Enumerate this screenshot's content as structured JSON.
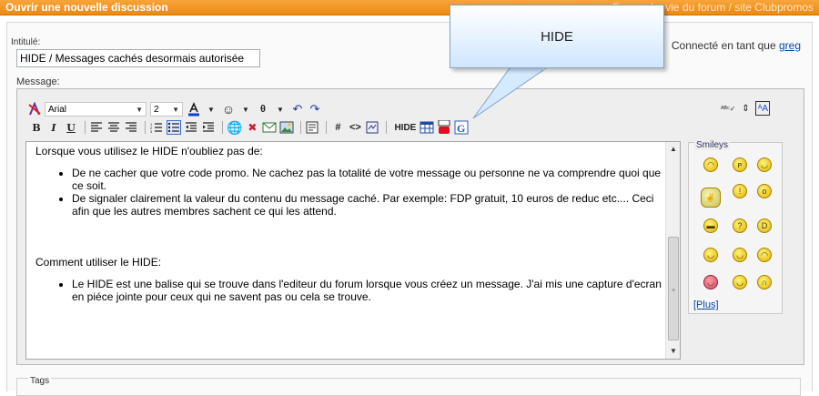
{
  "header": {
    "title": "Ouvrir une nouvelle discussion",
    "forum_text": "Forum: La vie du forum / site Clubpromos"
  },
  "form": {
    "subject_label": "Intitulé:",
    "subject_value": "HIDE / Messages cachés desormais autorisée",
    "connected_prefix": "Connecté en tant que",
    "connected_user": "greg",
    "message_label": "Message:"
  },
  "toolbar": {
    "font_value": "Arial",
    "size_value": "2",
    "hide_button": "HIDE"
  },
  "callout": {
    "text": "HIDE"
  },
  "message": {
    "intro": "Lorsque vous utilisez le HIDE n'oubliez pas de:",
    "bullets1": [
      "De ne cacher que votre code promo. Ne cachez pas la totalité de votre message ou personne ne va comprendre quoi que ce soit.",
      "De signaler clairement la valeur du contenu du message caché. Par exemple: FDP gratuit, 10 euros de reduc etc.... Ceci afin que les autres membres sachent ce qui les attend."
    ],
    "howto": "Comment utiliser le HIDE:",
    "bullets2": [
      "Le HIDE est une balise qui se trouve dans l'editeur du forum lorsque vous créez un message. J'ai mis une capture d'ecran en piéce jointe pour ceux qui ne savent pas ou cela se trouve."
    ]
  },
  "smileys": {
    "legend": "Smileys",
    "plus_label": "[Plus]"
  },
  "tags": {
    "legend": "Tags"
  }
}
